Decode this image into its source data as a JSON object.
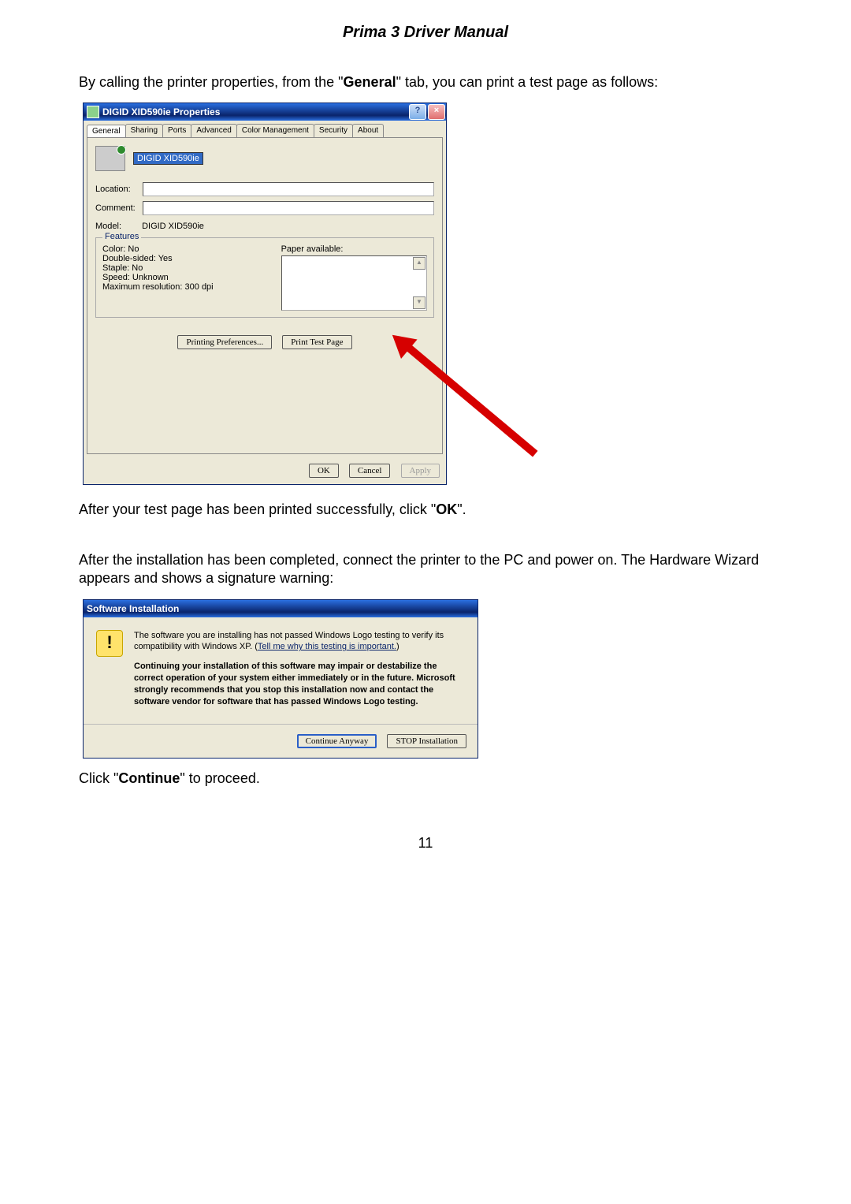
{
  "doc_title": "Prima 3 Driver Manual",
  "para1_pre": "By calling the printer properties, from the \"",
  "para1_bold": "General",
  "para1_post": "\" tab, you can print a test page as follows:",
  "props_dialog": {
    "title": "DIGID XID590ie Properties",
    "tabs": {
      "general": "General",
      "sharing": "Sharing",
      "ports": "Ports",
      "advanced": "Advanced",
      "color": "Color Management",
      "security": "Security",
      "about": "About"
    },
    "printer_name": "DIGID XID590ie",
    "location_label": "Location:",
    "comment_label": "Comment:",
    "model_label": "Model:",
    "model_value": "DIGID XID590ie",
    "features_legend": "Features",
    "feat_color": "Color: No",
    "feat_double": "Double-sided: Yes",
    "feat_staple": "Staple: No",
    "feat_speed": "Speed: Unknown",
    "feat_res": "Maximum resolution: 300 dpi",
    "paper_label": "Paper available:",
    "btn_prefs": "Printing Preferences...",
    "btn_test": "Print Test Page",
    "btn_ok": "OK",
    "btn_cancel": "Cancel",
    "btn_apply": "Apply"
  },
  "para2_pre": "After your test page has been printed successfully, click \"",
  "para2_bold": "OK",
  "para2_post": "\".",
  "para3": "After the installation has been completed, connect the printer to the PC and power on. The Hardware Wizard appears and shows a signature warning:",
  "sw_dialog": {
    "title": "Software Installation",
    "text1": "The software you are installing has not passed Windows Logo testing to verify its compatibility with Windows XP. (",
    "link": "Tell me why this testing is important.",
    "text1_post": ")",
    "text2": "Continuing your installation of this software may impair or destabilize the correct operation of your system either immediately or in the future. Microsoft strongly recommends that you stop this installation now and contact the software vendor for software that has passed Windows Logo testing.",
    "btn_continue": "Continue Anyway",
    "btn_stop": "STOP Installation"
  },
  "para4_pre": "Click \"",
  "para4_bold": "Continue",
  "para4_post": "\" to proceed.",
  "page_number": "11"
}
